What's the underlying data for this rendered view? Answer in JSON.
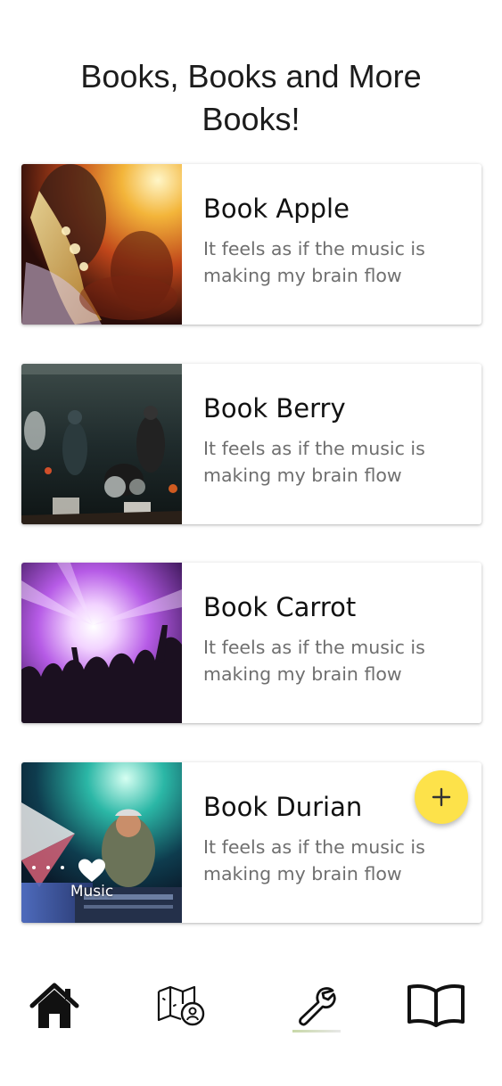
{
  "header": {
    "title": "Books, Books and More Books!"
  },
  "cards": [
    {
      "title": "Book Apple",
      "description": "It feels as if the music is making my brain flow",
      "image": "saxophone-concert-photo"
    },
    {
      "title": "Book Berry",
      "description": "It feels as if the music is making my brain flow",
      "image": "band-on-stage-photo"
    },
    {
      "title": "Book Carrot",
      "description": "It feels as if the music is making my brain flow",
      "image": "concert-crowd-lights-photo"
    },
    {
      "title": "Book Durian",
      "description": "It feels as if the music is making my brain flow",
      "image": "dj-at-mixer-photo"
    }
  ],
  "overlay": {
    "music_label": "Music",
    "icon": "heart-icon"
  },
  "fab": {
    "icon": "plus-icon",
    "color": "#fde24a"
  },
  "bottom_nav": {
    "items": [
      {
        "icon": "home-icon"
      },
      {
        "icon": "map-search-icon"
      },
      {
        "icon": "wrench-icon",
        "active": true
      },
      {
        "icon": "open-book-icon"
      }
    ]
  }
}
